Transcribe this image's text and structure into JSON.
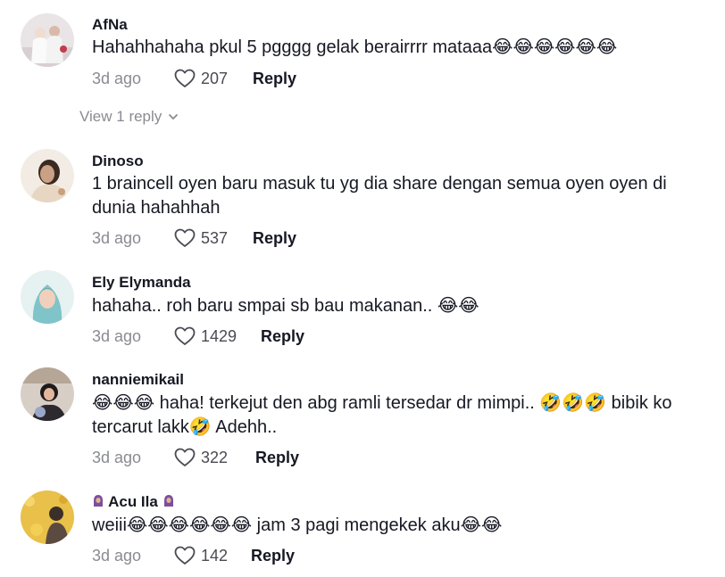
{
  "comments": [
    {
      "username": "AfNa",
      "text": "Hahahhahaha pkul 5 pgggg gelak berairrrr mataaa😂😂😂😂😂😂",
      "time": "3d ago",
      "likes": "207",
      "reply_label": "Reply",
      "view_replies": "View 1 reply"
    },
    {
      "username": "Dinoso",
      "text": "1 braincell oyen baru masuk tu yg dia share dengan semua oyen oyen di dunia hahahhah",
      "time": "3d ago",
      "likes": "537",
      "reply_label": "Reply"
    },
    {
      "username": "Ely Elymanda",
      "text": "hahaha.. roh baru smpai sb bau makanan.. 😂😂",
      "time": "3d ago",
      "likes": "1429",
      "reply_label": "Reply"
    },
    {
      "username": "nanniemikail",
      "text": "😂😂😂 haha! terkejut den abg ramli tersedar dr mimpi.. 🤣🤣🤣 bibik ko tercarut lakk🤣 Adehh..",
      "time": "3d ago",
      "likes": "322",
      "reply_label": "Reply"
    },
    {
      "username": "Acu Ila",
      "text": "weiii😂😂😂😂😂😂 jam 3 pagi mengekek aku😂😂",
      "time": "3d ago",
      "likes": "142",
      "reply_label": "Reply"
    }
  ],
  "colors": {
    "text": "#161823",
    "muted": "#8a8b91",
    "background": "#ffffff"
  },
  "icons": [
    "heart-outline-icon",
    "chevron-down-icon",
    "hijab-person-icon"
  ]
}
